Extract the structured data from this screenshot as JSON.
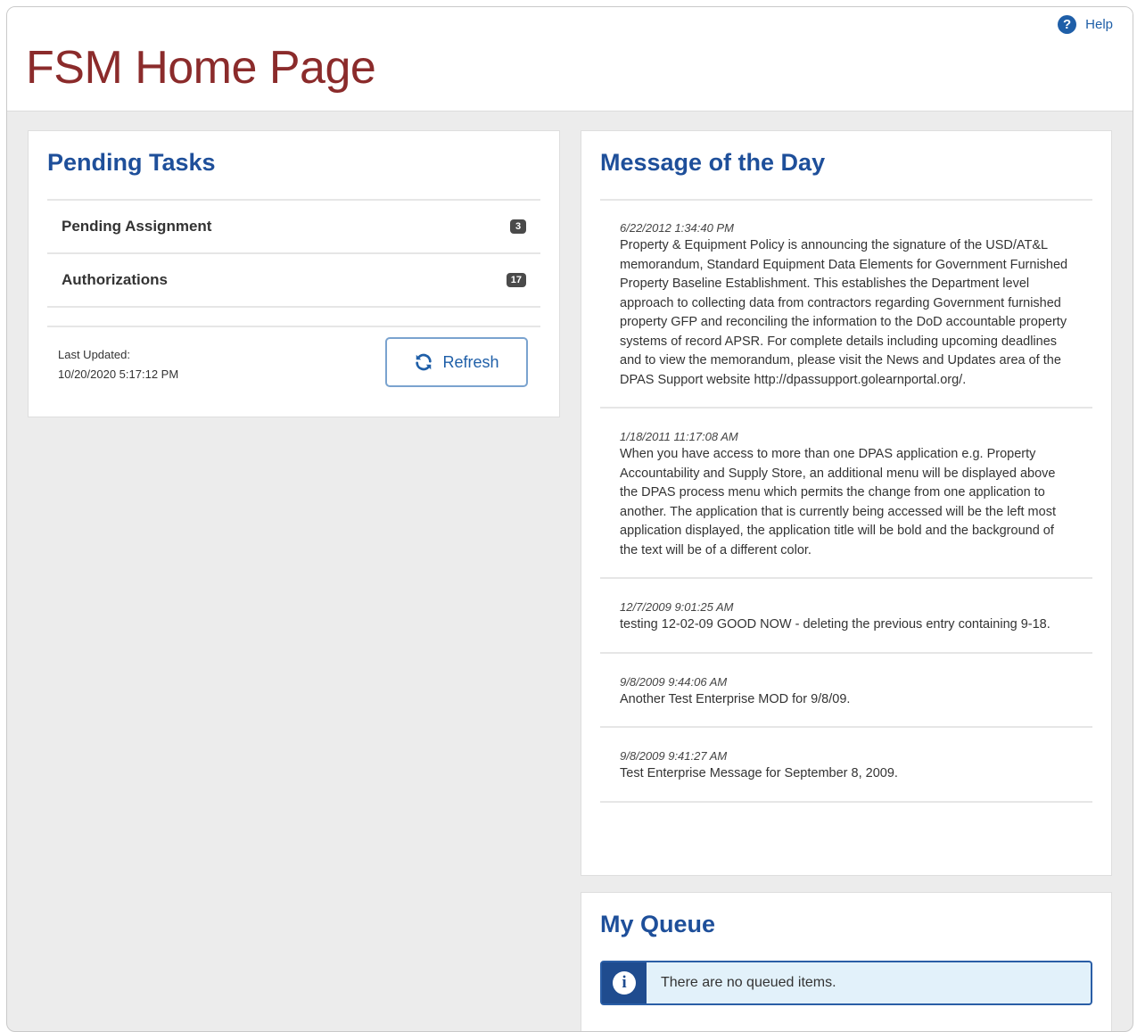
{
  "header": {
    "title": "FSM Home Page",
    "help_label": "Help",
    "help_icon": "question-circle-icon"
  },
  "pending_tasks": {
    "title": "Pending Tasks",
    "items": [
      {
        "label": "Pending Assignment",
        "count": "3"
      },
      {
        "label": "Authorizations",
        "count": "17"
      }
    ],
    "last_updated_label": "Last Updated:",
    "last_updated_value": "10/20/2020 5:17:12 PM",
    "refresh_label": "Refresh"
  },
  "motd": {
    "title": "Message of the Day",
    "messages": [
      {
        "date": "6/22/2012 1:34:40 PM",
        "text": "Property & Equipment Policy is announcing the signature of the USD/AT&L memorandum, Standard Equipment Data Elements for Government Furnished Property Baseline Establishment. This establishes the Department level approach to collecting data from contractors regarding Government furnished property GFP and reconciling the information to the DoD accountable property systems of record APSR. For complete details including upcoming deadlines and to view the memorandum, please visit the News and Updates area of the DPAS Support website http://dpassupport.golearnportal.org/."
      },
      {
        "date": "1/18/2011 11:17:08 AM",
        "text": "When you have access to more than one DPAS application e.g. Property Accountability and Supply Store, an additional menu will be displayed above the DPAS process menu which permits the change from one application to another. The application that is currently being accessed will be the left most application displayed, the application title will be bold and the background of the text will be of a different color."
      },
      {
        "date": "12/7/2009 9:01:25 AM",
        "text": "testing 12-02-09 GOOD NOW - deleting the previous entry containing 9-18."
      },
      {
        "date": "9/8/2009 9:44:06 AM",
        "text": "Another Test Enterprise MOD for 9/8/09."
      },
      {
        "date": "9/8/2009 9:41:27 AM",
        "text": "Test Enterprise Message for September 8, 2009."
      }
    ]
  },
  "queue": {
    "title": "My Queue",
    "empty_message": "There are no queued items.",
    "info_icon": "info-icon"
  }
}
